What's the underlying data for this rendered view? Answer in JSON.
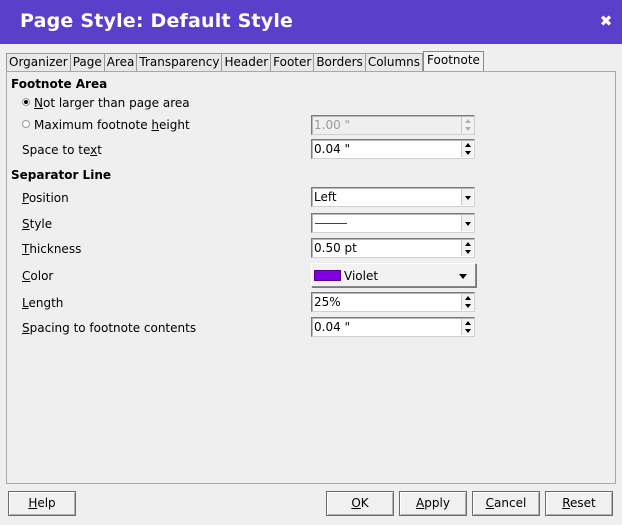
{
  "window": {
    "title": "Page Style: Default Style"
  },
  "tabs": [
    "Organizer",
    "Page",
    "Area",
    "Transparency",
    "Header",
    "Footer",
    "Borders",
    "Columns",
    "Footnote"
  ],
  "active_tab": "Footnote",
  "footnote_area": {
    "title": "Footnote Area",
    "not_larger": {
      "pre": "",
      "key": "N",
      "post": "ot larger than page area",
      "selected": true
    },
    "max_height": {
      "pre": "Maximum footnote ",
      "key": "h",
      "post": "eight",
      "selected": false,
      "value": "1.00 \""
    },
    "space_to_text": {
      "pre": "Space to te",
      "key": "x",
      "post": "t",
      "value": "0.04 \""
    }
  },
  "separator_line": {
    "title": "Separator Line",
    "position": {
      "key": "P",
      "post": "osition",
      "value": "Left"
    },
    "style": {
      "key": "S",
      "post": "tyle",
      "value": ""
    },
    "thickness": {
      "key": "T",
      "post": "hickness",
      "value": "0.50 pt"
    },
    "color": {
      "key": "C",
      "post": "olor",
      "value": "Violet",
      "swatch": "#8000e0"
    },
    "length": {
      "key": "L",
      "post": "ength",
      "value": "25%"
    },
    "spacing": {
      "key": "S",
      "post": "pacing to footnote contents",
      "value": "0.04 \""
    }
  },
  "buttons": {
    "help": {
      "key": "H",
      "post": "elp"
    },
    "ok": {
      "key": "O",
      "post": "K"
    },
    "apply": {
      "key": "A",
      "post": "pply"
    },
    "cancel": {
      "key": "C",
      "post": "ancel"
    },
    "reset": {
      "key": "R",
      "post": "eset"
    }
  },
  "colors": {
    "titlebar": "#5a3fcb",
    "line_sample": "#8000e0"
  }
}
